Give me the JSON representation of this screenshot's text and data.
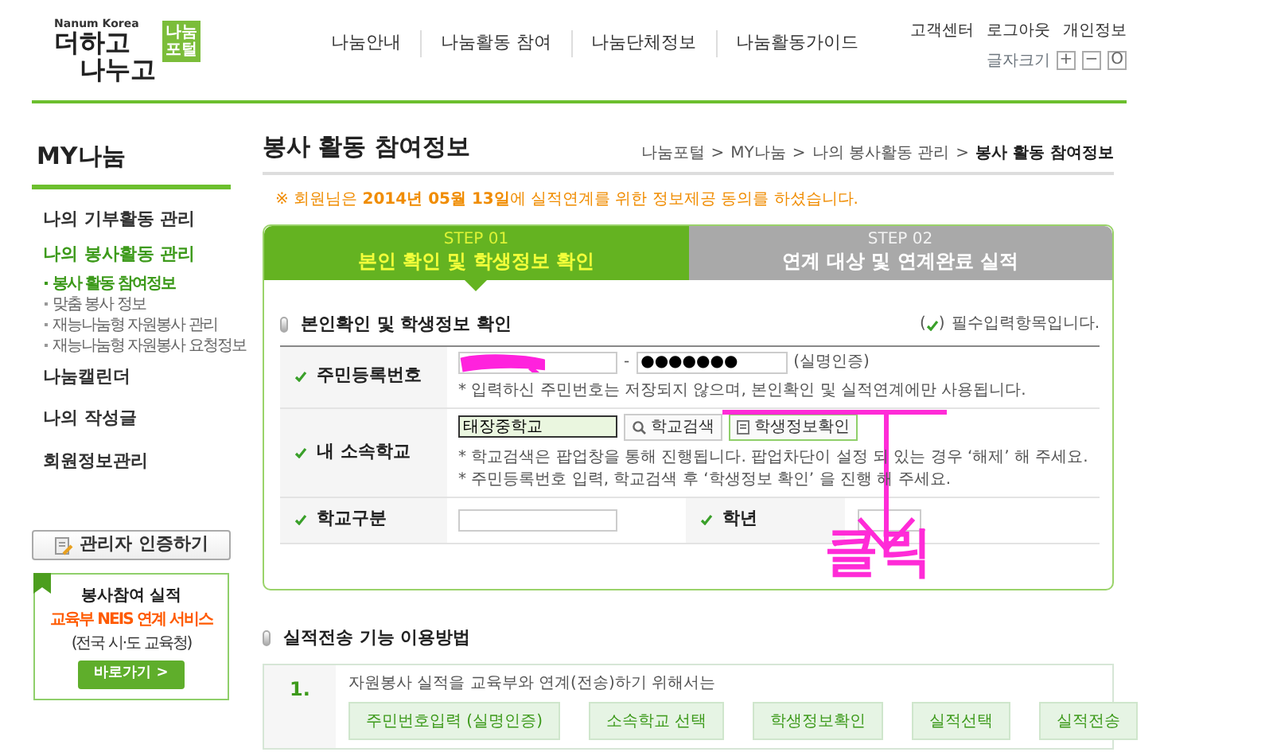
{
  "header": {
    "logo": {
      "tagline": "Nanum Korea",
      "badge": [
        "나눔",
        "포털"
      ],
      "lines": [
        "더하고",
        "나누고"
      ]
    },
    "nav": [
      "나눔안내",
      "나눔활동 참여",
      "나눔단체정보",
      "나눔활동가이드"
    ],
    "util_links": [
      "고객센터",
      "로그아웃",
      "개인정보"
    ],
    "font_size": {
      "label": "글자크기",
      "buttons": [
        "+",
        "−",
        "O"
      ]
    }
  },
  "sidebar": {
    "title": "MY나눔",
    "items": [
      {
        "label": "나의 기부활동 관리",
        "selected": false
      },
      {
        "label": "나의 봉사활동 관리",
        "selected": true,
        "children": [
          {
            "label": "봉사 활동 참여정보",
            "selected": true
          },
          {
            "label": "맞춤 봉사 정보",
            "selected": false
          },
          {
            "label": "재능나눔형 자원봉사 관리",
            "selected": false
          },
          {
            "label": "재능나눔형 자원봉사 요청정보",
            "selected": false
          }
        ]
      },
      {
        "label": "나눔캘린더",
        "selected": false
      },
      {
        "label": "나의 작성글",
        "selected": false
      },
      {
        "label": "회원정보관리",
        "selected": false
      }
    ],
    "admin_button": "관리자 인증하기",
    "promo": {
      "title": "봉사참여 실적",
      "highlight": "교육부 NEIS 연계 서비스",
      "subtitle": "(전국 시·도 교육청)",
      "button": "바로가기 >"
    }
  },
  "page": {
    "title": "봉사 활동 참여정보",
    "breadcrumb": [
      "나눔포털",
      "MY나눔",
      "나의 봉사활동 관리",
      "봉사 활동 참여정보"
    ],
    "separator": ">",
    "notice": "※ 회원님은 **2014년 05월 13일**에 실적연계를 위한 정보제공 동의를 하셨습니다.",
    "steps": [
      {
        "step": "STEP 01",
        "title": "본인 확인 및 학생정보 확인",
        "selected": true
      },
      {
        "step": "STEP 02",
        "title": "연계 대상 및 연계완료 실적",
        "selected": false
      }
    ],
    "form": {
      "title": "본인확인 및 학생정보 확인",
      "required_note": [
        "(",
        ")",
        "필수입력항목입니다."
      ],
      "id_row": {
        "label": "주민등록번호",
        "dash": "-",
        "masked": "●●●●●●●",
        "suffix": "(실명인증)",
        "hint": "* 입력하신 주민번호는 저장되지 않으며, 본인확인 및 실적연계에만 사용됩니다."
      },
      "school_row": {
        "label": "내 소속학교",
        "value": "태장중학교",
        "buttons": [
          "학교검색",
          "학생정보확인"
        ],
        "hints": [
          "* 학교검색은 팝업창을 통해 진행됩니다. 팝업차단이 설정 되 있는 경우 ‘해제’ 해 주세요.",
          "* 주민등록번호 입력, 학교검색 후 ‘학생정보 확인’ 을 진행 해 주세요."
        ]
      },
      "type_row": {
        "label": "학교구분",
        "grade_label": "학년"
      }
    },
    "annotation": "클릭",
    "guide": {
      "title": "실적전송 기능 이용방법",
      "number": "1.",
      "text": "자원봉사 실적을 교육부와 연계(전송)하기 위해서는",
      "steps": [
        "주민번호입력 (실명인증)",
        "소속학교 선택",
        "학생정보확인",
        "실적선택",
        "실적전송"
      ]
    }
  }
}
